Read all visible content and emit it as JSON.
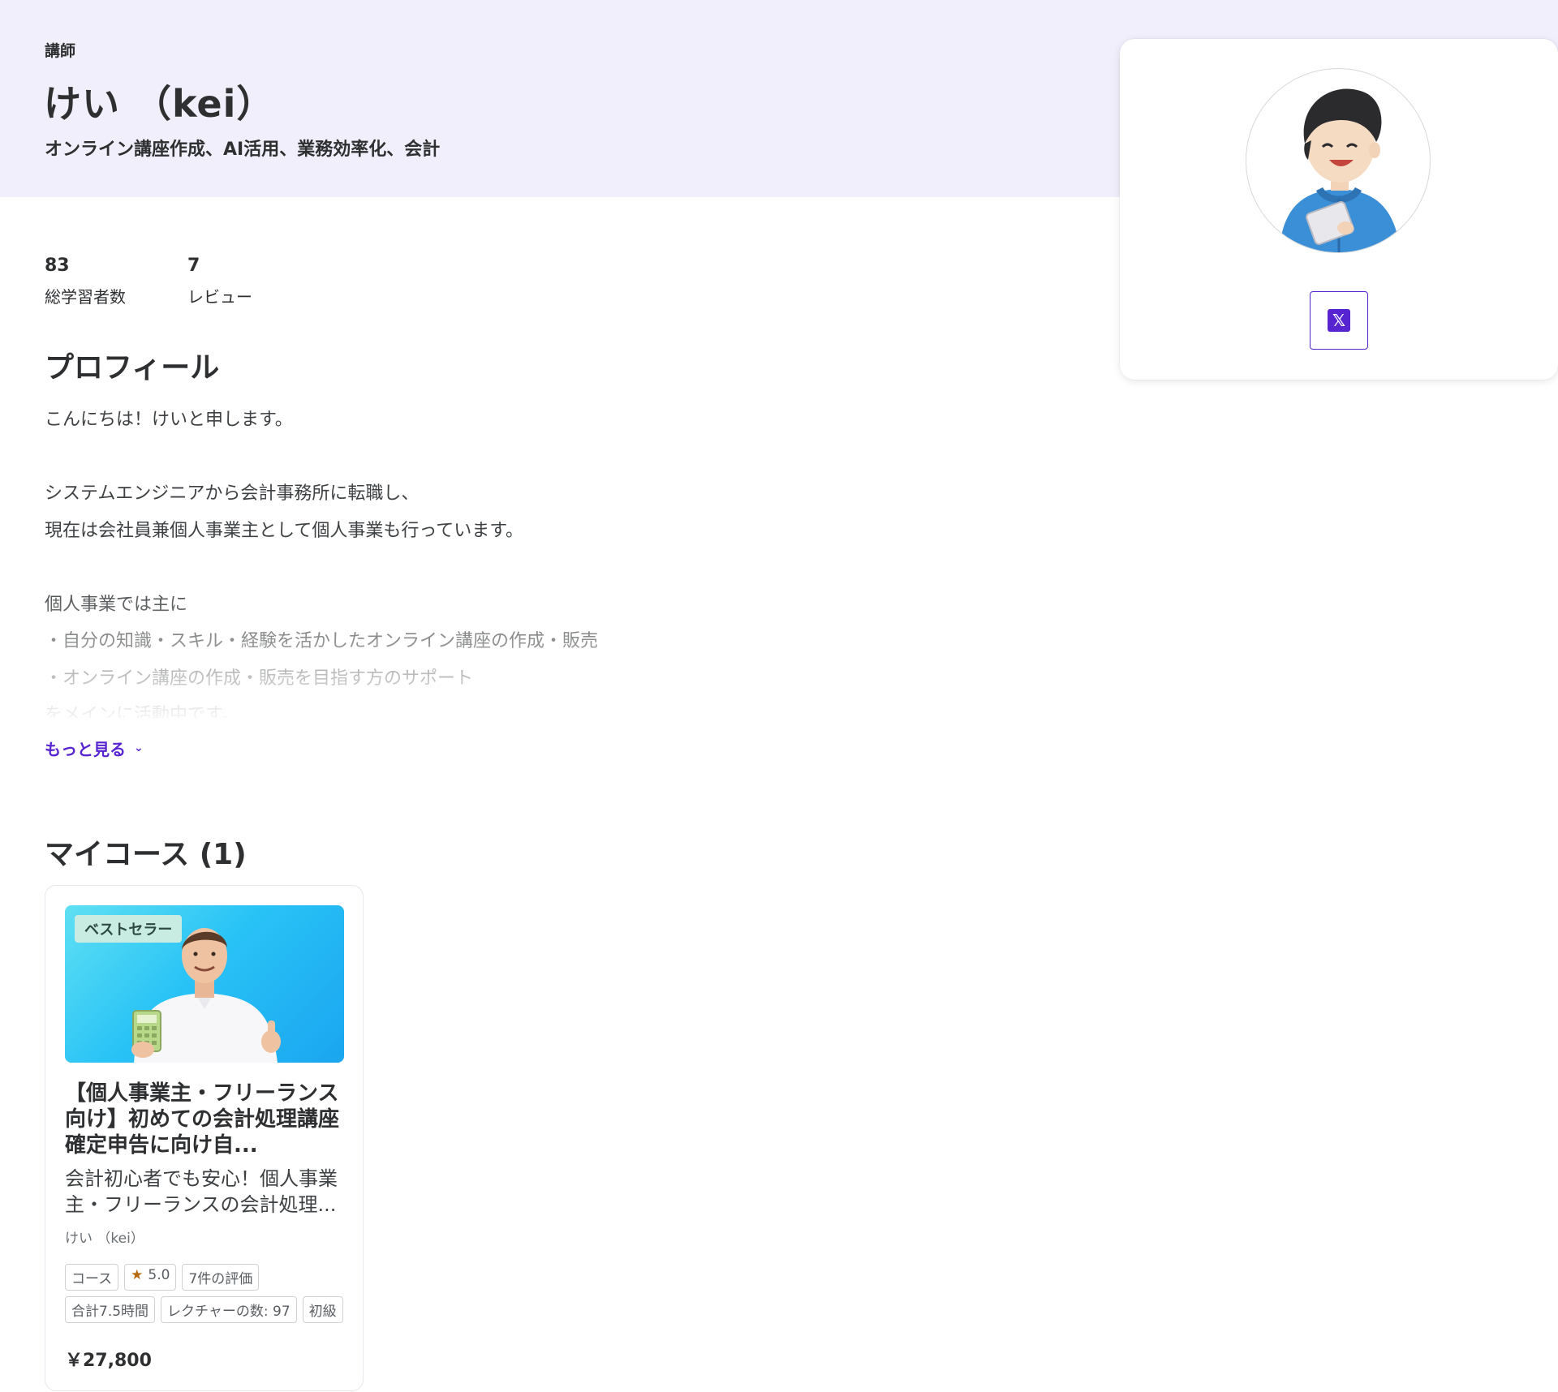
{
  "header": {
    "role_label": "講師",
    "instructor_name": "けい （kei）",
    "headline": "オンライン講座作成、AI活用、業務効率化、会計"
  },
  "stats": [
    {
      "value": "83",
      "label": "総学習者数"
    },
    {
      "value": "7",
      "label": "レビュー"
    }
  ],
  "profile": {
    "title": "プロフィール",
    "lines": [
      "こんにちは！けいと申します。",
      "",
      "システムエンジニアから会計事務所に転職し、",
      "現在は会社員兼個人事業主として個人事業も行っています。",
      "",
      "個人事業では主に",
      "・自分の知識・スキル・経験を活かしたオンライン講座の作成・販売",
      "・オンライン講座の作成・販売を目指す方のサポート",
      "をメインに活動中です。"
    ],
    "show_more": "もっと見る"
  },
  "courses": {
    "title": "マイコース (1)",
    "items": [
      {
        "badge": "ベストセラー",
        "title": "【個人事業主・フリーランス向け】初めての会計処理講座　確定申告に向け自...",
        "description": "会計初心者でも安心！個人事業主・フリーランスの会計処理...",
        "author": "けい （kei）",
        "tags": [
          "コース",
          "5.0",
          "7件の評価",
          "合計7.5時間",
          "レクチャーの数: 97",
          "初級"
        ],
        "price": "￥27,800"
      }
    ]
  },
  "side_card": {
    "social_icon": "x-icon",
    "social_glyph": "𝕏"
  },
  "colors": {
    "accent": "#5624d0",
    "header_band": "#f0effb",
    "star": "#b4690e"
  }
}
